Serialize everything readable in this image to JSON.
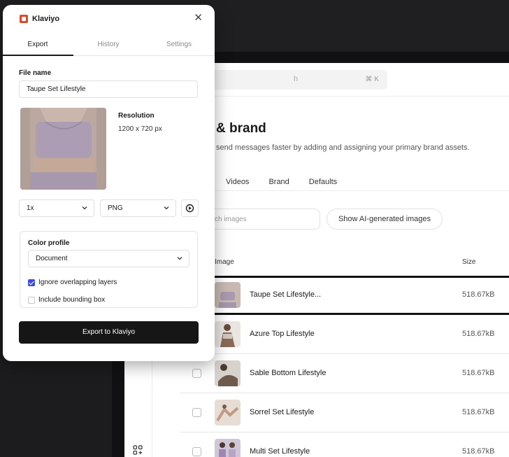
{
  "panel": {
    "brand": "Klaviyo",
    "tabs": [
      {
        "label": "Export",
        "active": true
      },
      {
        "label": "History",
        "active": false
      },
      {
        "label": "Settings",
        "active": false
      }
    ],
    "file_name_label": "File name",
    "file_name_value": "Taupe Set Lifestyle",
    "resolution_label": "Resolution",
    "resolution_value": "1200 x 720 px",
    "scale_value": "1x",
    "format_value": "PNG",
    "color_profile_label": "Color profile",
    "color_profile_value": "Document",
    "options": [
      {
        "label": "Ignore overlapping layers",
        "checked": true
      },
      {
        "label": "Include bounding box",
        "checked": false
      }
    ],
    "export_button": "Export to Klaviyo",
    "accent_color": "#3b4be0",
    "logo_color": "#e04b2c"
  },
  "app": {
    "search_hint": "h",
    "search_shortcut": "⌘ K",
    "page_title": "& brand",
    "page_description": "send messages faster by adding and assigning your primary brand assets.",
    "tabs": [
      "Videos",
      "Brand",
      "Defaults"
    ],
    "image_search_placeholder": "ch images",
    "ai_button": "Show AI-generated images",
    "columns": {
      "image": "Image",
      "size": "Size"
    },
    "rows": [
      {
        "name": "Taupe Set Lifestyle...",
        "size": "518.67kB",
        "selected": true
      },
      {
        "name": "Azure Top Lifestyle",
        "size": "518.67kB",
        "selected": false
      },
      {
        "name": "Sable Bottom Lifestyle",
        "size": "518.67kB",
        "selected": false
      },
      {
        "name": "Sorrel Set Lifestyle",
        "size": "518.67kB",
        "selected": false
      },
      {
        "name": "Multi Set Lifestyle",
        "size": "518.67kB",
        "selected": false
      }
    ]
  }
}
